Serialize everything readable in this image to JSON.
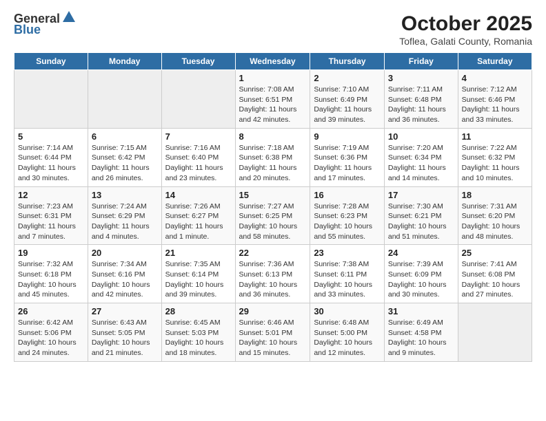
{
  "header": {
    "logo_general": "General",
    "logo_blue": "Blue",
    "title": "October 2025",
    "subtitle": "Toflea, Galati County, Romania"
  },
  "days_of_week": [
    "Sunday",
    "Monday",
    "Tuesday",
    "Wednesday",
    "Thursday",
    "Friday",
    "Saturday"
  ],
  "weeks": [
    [
      {
        "day": "",
        "info": ""
      },
      {
        "day": "",
        "info": ""
      },
      {
        "day": "",
        "info": ""
      },
      {
        "day": "1",
        "info": "Sunrise: 7:08 AM\nSunset: 6:51 PM\nDaylight: 11 hours and 42 minutes."
      },
      {
        "day": "2",
        "info": "Sunrise: 7:10 AM\nSunset: 6:49 PM\nDaylight: 11 hours and 39 minutes."
      },
      {
        "day": "3",
        "info": "Sunrise: 7:11 AM\nSunset: 6:48 PM\nDaylight: 11 hours and 36 minutes."
      },
      {
        "day": "4",
        "info": "Sunrise: 7:12 AM\nSunset: 6:46 PM\nDaylight: 11 hours and 33 minutes."
      }
    ],
    [
      {
        "day": "5",
        "info": "Sunrise: 7:14 AM\nSunset: 6:44 PM\nDaylight: 11 hours and 30 minutes."
      },
      {
        "day": "6",
        "info": "Sunrise: 7:15 AM\nSunset: 6:42 PM\nDaylight: 11 hours and 26 minutes."
      },
      {
        "day": "7",
        "info": "Sunrise: 7:16 AM\nSunset: 6:40 PM\nDaylight: 11 hours and 23 minutes."
      },
      {
        "day": "8",
        "info": "Sunrise: 7:18 AM\nSunset: 6:38 PM\nDaylight: 11 hours and 20 minutes."
      },
      {
        "day": "9",
        "info": "Sunrise: 7:19 AM\nSunset: 6:36 PM\nDaylight: 11 hours and 17 minutes."
      },
      {
        "day": "10",
        "info": "Sunrise: 7:20 AM\nSunset: 6:34 PM\nDaylight: 11 hours and 14 minutes."
      },
      {
        "day": "11",
        "info": "Sunrise: 7:22 AM\nSunset: 6:32 PM\nDaylight: 11 hours and 10 minutes."
      }
    ],
    [
      {
        "day": "12",
        "info": "Sunrise: 7:23 AM\nSunset: 6:31 PM\nDaylight: 11 hours and 7 minutes."
      },
      {
        "day": "13",
        "info": "Sunrise: 7:24 AM\nSunset: 6:29 PM\nDaylight: 11 hours and 4 minutes."
      },
      {
        "day": "14",
        "info": "Sunrise: 7:26 AM\nSunset: 6:27 PM\nDaylight: 11 hours and 1 minute."
      },
      {
        "day": "15",
        "info": "Sunrise: 7:27 AM\nSunset: 6:25 PM\nDaylight: 10 hours and 58 minutes."
      },
      {
        "day": "16",
        "info": "Sunrise: 7:28 AM\nSunset: 6:23 PM\nDaylight: 10 hours and 55 minutes."
      },
      {
        "day": "17",
        "info": "Sunrise: 7:30 AM\nSunset: 6:21 PM\nDaylight: 10 hours and 51 minutes."
      },
      {
        "day": "18",
        "info": "Sunrise: 7:31 AM\nSunset: 6:20 PM\nDaylight: 10 hours and 48 minutes."
      }
    ],
    [
      {
        "day": "19",
        "info": "Sunrise: 7:32 AM\nSunset: 6:18 PM\nDaylight: 10 hours and 45 minutes."
      },
      {
        "day": "20",
        "info": "Sunrise: 7:34 AM\nSunset: 6:16 PM\nDaylight: 10 hours and 42 minutes."
      },
      {
        "day": "21",
        "info": "Sunrise: 7:35 AM\nSunset: 6:14 PM\nDaylight: 10 hours and 39 minutes."
      },
      {
        "day": "22",
        "info": "Sunrise: 7:36 AM\nSunset: 6:13 PM\nDaylight: 10 hours and 36 minutes."
      },
      {
        "day": "23",
        "info": "Sunrise: 7:38 AM\nSunset: 6:11 PM\nDaylight: 10 hours and 33 minutes."
      },
      {
        "day": "24",
        "info": "Sunrise: 7:39 AM\nSunset: 6:09 PM\nDaylight: 10 hours and 30 minutes."
      },
      {
        "day": "25",
        "info": "Sunrise: 7:41 AM\nSunset: 6:08 PM\nDaylight: 10 hours and 27 minutes."
      }
    ],
    [
      {
        "day": "26",
        "info": "Sunrise: 6:42 AM\nSunset: 5:06 PM\nDaylight: 10 hours and 24 minutes."
      },
      {
        "day": "27",
        "info": "Sunrise: 6:43 AM\nSunset: 5:05 PM\nDaylight: 10 hours and 21 minutes."
      },
      {
        "day": "28",
        "info": "Sunrise: 6:45 AM\nSunset: 5:03 PM\nDaylight: 10 hours and 18 minutes."
      },
      {
        "day": "29",
        "info": "Sunrise: 6:46 AM\nSunset: 5:01 PM\nDaylight: 10 hours and 15 minutes."
      },
      {
        "day": "30",
        "info": "Sunrise: 6:48 AM\nSunset: 5:00 PM\nDaylight: 10 hours and 12 minutes."
      },
      {
        "day": "31",
        "info": "Sunrise: 6:49 AM\nSunset: 4:58 PM\nDaylight: 10 hours and 9 minutes."
      },
      {
        "day": "",
        "info": ""
      }
    ]
  ]
}
